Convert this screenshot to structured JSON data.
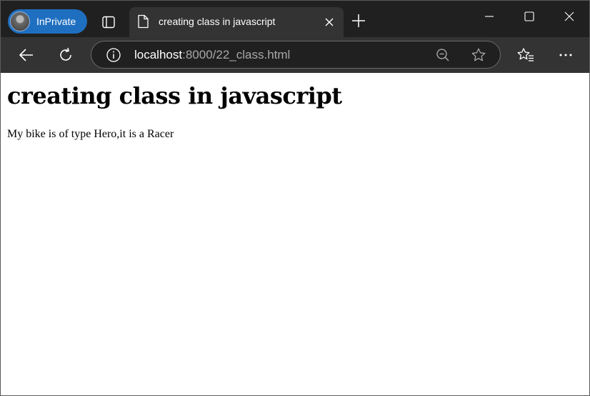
{
  "browser": {
    "profile_label": "InPrivate",
    "tab_title": "creating class in javascript",
    "address": {
      "host": "localhost",
      "rest": ":8000/22_class.html"
    }
  },
  "page": {
    "heading": "creating class in javascript",
    "paragraph": "My bike is of type Hero,it is a Racer"
  },
  "colors": {
    "tabstrip_bg": "#202020",
    "toolbar_bg": "#333333",
    "inprivate_badge": "#1f6fc0"
  },
  "icons": [
    "tab-actions-icon",
    "page-icon",
    "close-icon",
    "plus-icon",
    "minimize-icon",
    "maximize-icon",
    "close-window-icon",
    "back-arrow-icon",
    "refresh-icon",
    "info-icon",
    "zoom-out-icon",
    "star-icon",
    "favorites-icon",
    "more-icon"
  ]
}
